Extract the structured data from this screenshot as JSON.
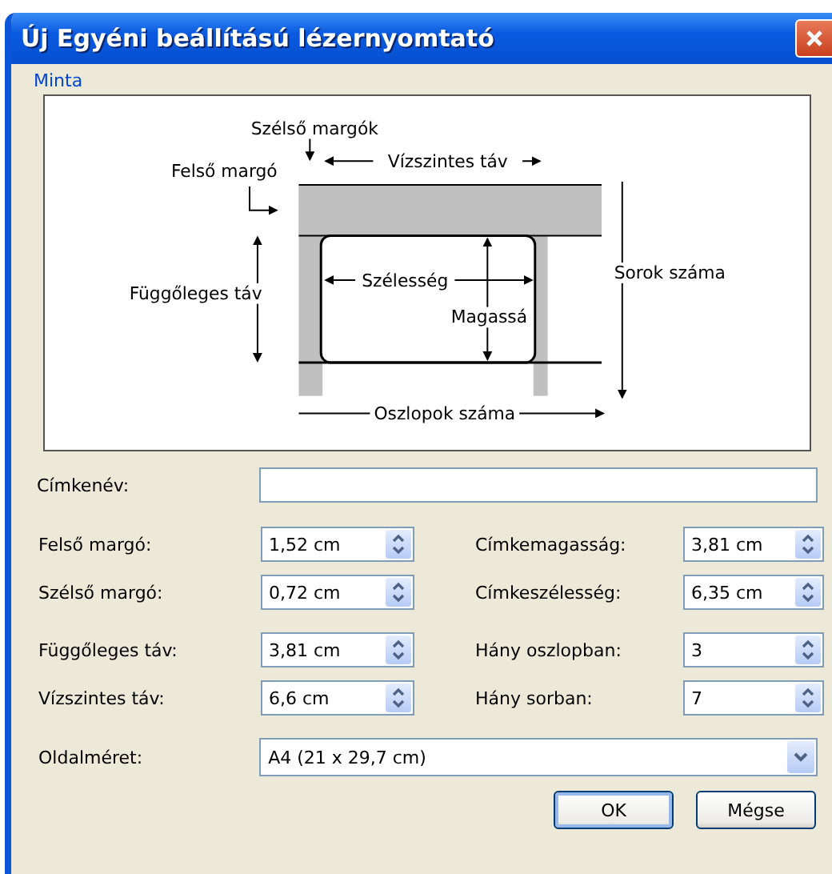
{
  "window": {
    "title": "Új Egyéni beállítású lézernyomtató"
  },
  "preview": {
    "label": "Minta",
    "diagram_labels": [
      "Szélső margók",
      "Felső margó",
      "Vízszintes táv",
      "Függőleges táv",
      "Szélesség",
      "Magassá",
      "Sorok száma",
      "Oszlopok száma"
    ]
  },
  "name_field": {
    "label": "Címkenév:"
  },
  "field_groups": [
    [
      {
        "label": "Felső margó:",
        "value": "1,52 cm",
        "right_label": "Címkemagasság:",
        "right_value": "3,81 cm"
      },
      {
        "label": "Szélső margó:",
        "value": "0,72 cm",
        "right_label": "Címkeszélesség:",
        "right_value": "6,35 cm"
      }
    ],
    [
      {
        "label": "Függőleges táv:",
        "value": "3,81 cm",
        "right_label": "Hány oszlopban:",
        "right_value": "3"
      },
      {
        "label": "Vízszintes táv:",
        "value": "6,6 cm",
        "right_label": "Hány sorban:",
        "right_value": "7"
      }
    ]
  ],
  "page_size": {
    "label": "Oldalméret:",
    "value": "A4 (21 x 29,7 cm)"
  },
  "buttons": [
    "OK",
    "Mégse"
  ]
}
